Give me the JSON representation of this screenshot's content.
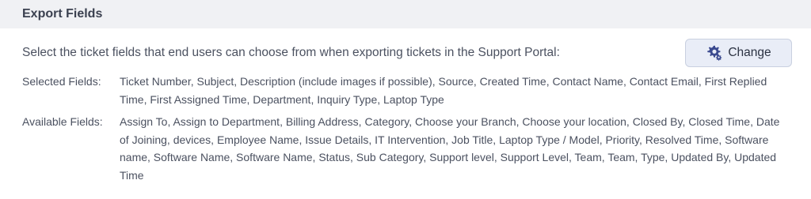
{
  "panel": {
    "title": "Export Fields"
  },
  "intro": {
    "text": "Select the ticket fields that end users can choose from when exporting tickets in the Support Portal:"
  },
  "change_button": {
    "label": "Change",
    "icon": "gear-icon",
    "accent_color": "#3b4a8f"
  },
  "selected_fields": {
    "label": "Selected Fields:",
    "values": "Ticket Number, Subject, Description (include images if possible), Source, Created Time, Contact Name, Contact Email, First Replied Time, First Assigned Time, Department, Inquiry Type, Laptop Type"
  },
  "available_fields": {
    "label": "Available Fields:",
    "values": "Assign To, Assign to Department, Billing Address, Category, Choose your Branch, Choose your location, Closed By, Closed Time, Date of Joining, devices, Employee Name, Issue Details, IT Intervention, Job Title, Laptop Type / Model, Priority, Resolved Time, Software name, Software Name, Software Name, Status, Sub Category, Support level, Support Level, Team, Team, Type, Updated By, Updated Time"
  }
}
